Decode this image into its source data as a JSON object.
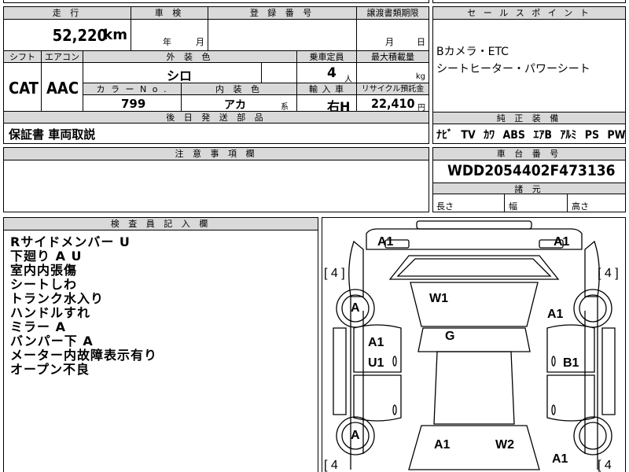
{
  "top_strip": {
    "partial_text": ""
  },
  "main_table": {
    "odometer_label": "走 行",
    "odometer_value": "52,220",
    "odometer_unit": "km",
    "inspection_label": "車 検",
    "inspection_year_unit": "年",
    "inspection_month_unit": "月",
    "registration_label": "登 録 番 号",
    "registration_value": "",
    "transfer_label": "譲渡書類期限",
    "transfer_month_unit": "月",
    "transfer_day_unit": "日",
    "shift_label": "シフト",
    "shift_value": "CAT",
    "aircon_label": "エアコン",
    "aircon_value": "AAC",
    "exterior_color_label": "外 装 色",
    "exterior_color_value": "シロ",
    "capacity_label": "乗車定員",
    "capacity_value": "4",
    "capacity_unit": "人",
    "max_load_label": "最大積載量",
    "max_load_unit": "kg",
    "color_no_label": "カ ラ ー N o .",
    "color_no_value": "799",
    "interior_color_label": "内 装 色",
    "interior_color_value": "アカ",
    "interior_color_suffix": "系",
    "import_label": "輸 入 車",
    "import_value": "右H",
    "recycle_label": "リサイクル預託金",
    "recycle_value": "22,410",
    "recycle_unit": "円",
    "later_parts_label": "後 日 発 送 部 品",
    "later_parts_value": "保証書 車両取説",
    "notes_label": "注 意 事 項 欄",
    "notes_value": ""
  },
  "sales_point": {
    "label": "セ ー ル ス ポ イ ン ト",
    "lines": [
      "Bカメラ・ETC",
      "シートヒーター・パワーシート"
    ]
  },
  "equipment": {
    "label": "純 正 装 備",
    "items": [
      "ﾅﾋﾞ",
      "TV",
      "ｶﾜ",
      "ABS",
      "ｴｱB",
      "ｱﾙﾐ",
      "PS",
      "PW"
    ]
  },
  "vin": {
    "label": "車 台 番 号",
    "value": "WDD2054402F473136"
  },
  "dimensions": {
    "label": "諸 元",
    "length": "長さ",
    "width": "幅",
    "height": "高さ"
  },
  "inspector": {
    "label": "検 査 員 記 入 欄",
    "lines": [
      "Rサイドメンバー U",
      "下廻り A U",
      "室内内張傷",
      "シートしわ",
      "トランク水入り",
      "ハンドルすれ",
      "ミラー A",
      "バンパー下 A",
      "メーター内故障表示有り",
      "オープン不良"
    ]
  },
  "diagram": {
    "marks": {
      "front_left_a1": "A1",
      "front_right_a1": "A1",
      "front_left_tire": "[ 4 ]",
      "front_right_tire": "[ 4 ]",
      "front_left_wheel": "A",
      "windshield": "W1",
      "right_front": "A1",
      "roof": "G",
      "left_door_a1": "A1",
      "left_door_u1": "U1",
      "right_door_b1": "B1",
      "rear_left_wheel": "A",
      "rear_a1": "A1",
      "rear_w2": "W2",
      "rear_right_a1": "A1",
      "rear_left_tire": "[ 4",
      "rear_right_tire": "[ 4"
    }
  }
}
